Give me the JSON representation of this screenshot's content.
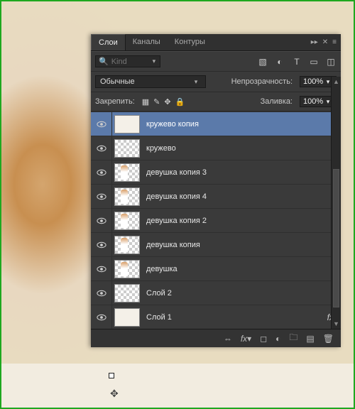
{
  "tabs": {
    "layers": "Слои",
    "channels": "Каналы",
    "paths": "Контуры"
  },
  "search": {
    "placeholder": "Kind"
  },
  "blend_mode": "Обычные",
  "opacity_label": "Непрозрачность:",
  "opacity_value": "100%",
  "lock_label": "Закрепить:",
  "fill_label": "Заливка:",
  "fill_value": "100%",
  "fx_label": "fx",
  "layers": [
    {
      "name": "кружево копия",
      "selected": true,
      "thumb": "lace"
    },
    {
      "name": "кружево",
      "selected": false,
      "thumb": "checker"
    },
    {
      "name": "девушка копия 3",
      "selected": false,
      "thumb": "girl"
    },
    {
      "name": "девушка копия 4",
      "selected": false,
      "thumb": "girl"
    },
    {
      "name": "девушка копия 2",
      "selected": false,
      "thumb": "girl"
    },
    {
      "name": "девушка копия",
      "selected": false,
      "thumb": "girl"
    },
    {
      "name": "девушка",
      "selected": false,
      "thumb": "girl"
    },
    {
      "name": "Слой 2",
      "selected": false,
      "thumb": "checker"
    },
    {
      "name": "Слой 1",
      "selected": false,
      "thumb": "lace",
      "fx": true
    }
  ]
}
